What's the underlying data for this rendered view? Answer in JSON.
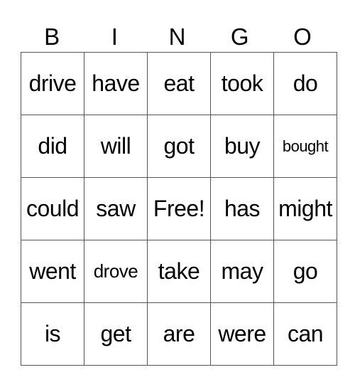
{
  "header": [
    "B",
    "I",
    "N",
    "G",
    "O"
  ],
  "rows": [
    [
      "drive",
      "have",
      "eat",
      "took",
      "do"
    ],
    [
      "did",
      "will",
      "got",
      "buy",
      "bought"
    ],
    [
      "could",
      "saw",
      "Free!",
      "has",
      "might"
    ],
    [
      "went",
      "drove",
      "take",
      "may",
      "go"
    ],
    [
      "is",
      "get",
      "are",
      "were",
      "can"
    ]
  ]
}
